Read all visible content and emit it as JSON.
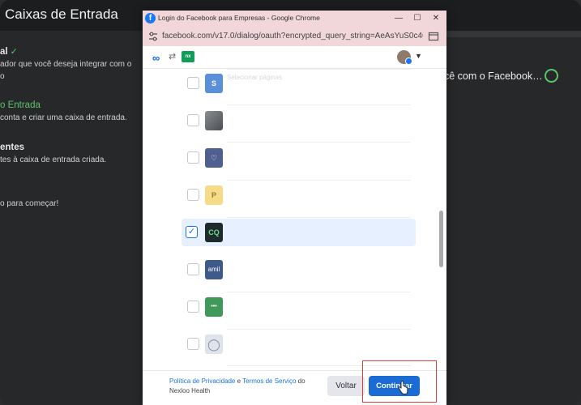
{
  "app": {
    "title": "Caixas de Entrada",
    "steps": [
      {
        "heading": "al",
        "heading_check": true,
        "desc": [
          "ador que você deseja integrar com o",
          "o"
        ]
      },
      {
        "heading": "o Entrada",
        "desc": [
          "conta e criar uma caixa de entrada."
        ]
      },
      {
        "heading": "entes",
        "desc": [
          "tes à caixa de entrada criada."
        ]
      },
      {
        "heading": "",
        "desc": [
          "o para começar!"
        ]
      }
    ],
    "facebook_option": "cê com o Facebook…"
  },
  "popup": {
    "window_title": "Login do Facebook para Empresas - Google Chrome",
    "url": "facebook.com/v17.0/dialog/oauth?encrypted_query_string=AeAsYuS0c4GW...",
    "header": {
      "meta_logo": "∞",
      "app_logo_text": "nx"
    },
    "list": [
      {
        "checked": false,
        "thumb": "S",
        "thumb_color": "#5b8fd9",
        "faded_text": "Selecionar páginas"
      },
      {
        "checked": false,
        "thumb": "",
        "thumb_color": "#6b6f73"
      },
      {
        "checked": false,
        "thumb": "♡",
        "thumb_color": "#5a6b9a"
      },
      {
        "checked": false,
        "thumb": "P",
        "thumb_color": "#f4d77a"
      },
      {
        "checked": true,
        "thumb": "CQ",
        "thumb_color": "#1f2a2a"
      },
      {
        "checked": false,
        "thumb": "amil",
        "thumb_color": "#3d5a8a"
      },
      {
        "checked": false,
        "thumb": "•••",
        "thumb_color": "#3f9a5a"
      },
      {
        "checked": false,
        "thumb": "◯",
        "thumb_color": "#9aa3ad"
      }
    ],
    "footer": {
      "policy_link": "Política de Privacidade",
      "and": " e ",
      "terms_link": "Termos de Serviço",
      "of": " do",
      "company": "Nexloo Health",
      "back_button": "Voltar",
      "continue_button": "Continuar"
    }
  },
  "colors": {
    "accent_green": "#5cc46a",
    "facebook_blue": "#1b6bd4",
    "highlight_red": "#e53935"
  }
}
